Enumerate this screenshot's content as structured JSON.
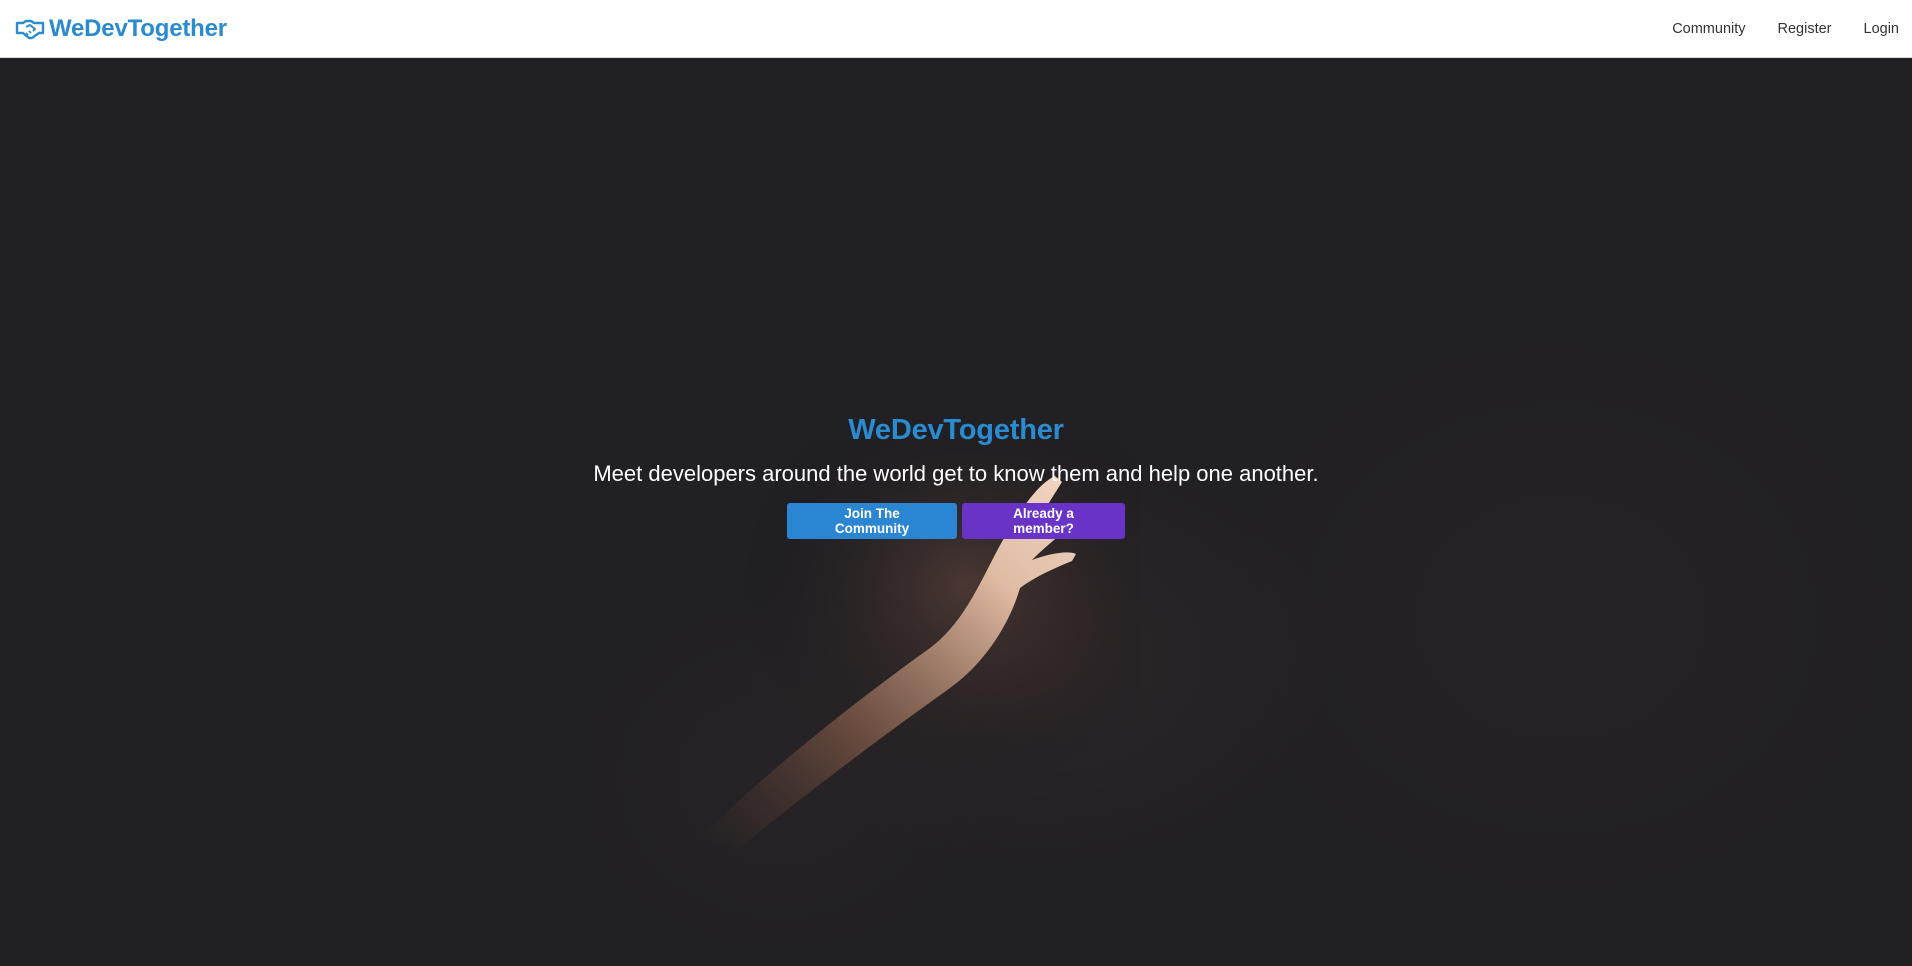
{
  "navbar": {
    "brand_icon": "handshake-icon",
    "brand_name": "WeDevTogether",
    "links": [
      {
        "label": "Community"
      },
      {
        "label": "Register"
      },
      {
        "label": "Login"
      }
    ]
  },
  "hero": {
    "title": "WeDevTogether",
    "subtitle": "Meet developers around the world get to know them and help one another.",
    "primary_button": "Join The Community",
    "secondary_button": "Already a member?"
  },
  "colors": {
    "brand_blue": "#2a8bd0",
    "primary_button": "#2a85d3",
    "secondary_button": "#6a33c7",
    "hero_background": "#212024",
    "navbar_background": "#ffffff"
  }
}
